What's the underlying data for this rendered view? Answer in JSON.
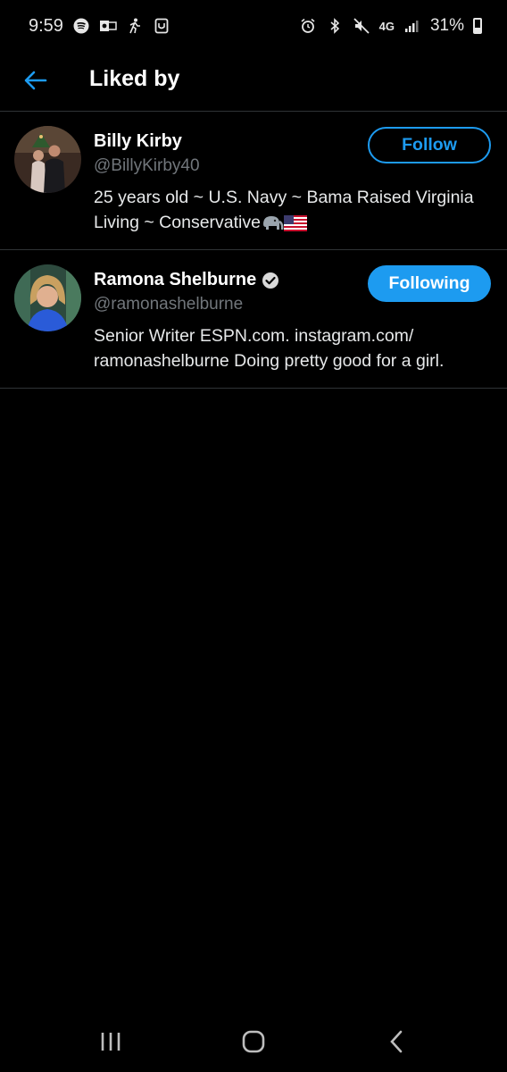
{
  "status_bar": {
    "time": "9:59",
    "battery": "31%",
    "left_icons": [
      "spotify-icon",
      "outlook-icon",
      "walk-icon",
      "app-icon"
    ],
    "right_icons": [
      "alarm-icon",
      "bluetooth-icon",
      "mute-icon",
      "lte-icon",
      "signal-icon",
      "battery-icon"
    ],
    "network": "4G"
  },
  "header": {
    "title": "Liked by",
    "back_icon": "arrow-left-icon"
  },
  "users": [
    {
      "name": "Billy Kirby",
      "handle": "@BillyKirby40",
      "bio": "25 years old ~ U.S. Navy ~ Bama Raised Virginia Living ~ Conservative",
      "button": "Follow",
      "verified": false
    },
    {
      "name": "Ramona Shelburne",
      "handle": "@ramonashelburne",
      "bio": "Senior Writer ESPN.com. instagram.com/ ramonashelburne Doing pretty good for a girl.",
      "button": "Following",
      "verified": true
    }
  ],
  "nav_bar": {
    "icons": [
      "recents-icon",
      "home-icon",
      "back-icon"
    ]
  },
  "colors": {
    "accent": "#1d9bf0",
    "background": "#000000",
    "secondary_text": "#71767b",
    "divider": "#2f3336"
  }
}
